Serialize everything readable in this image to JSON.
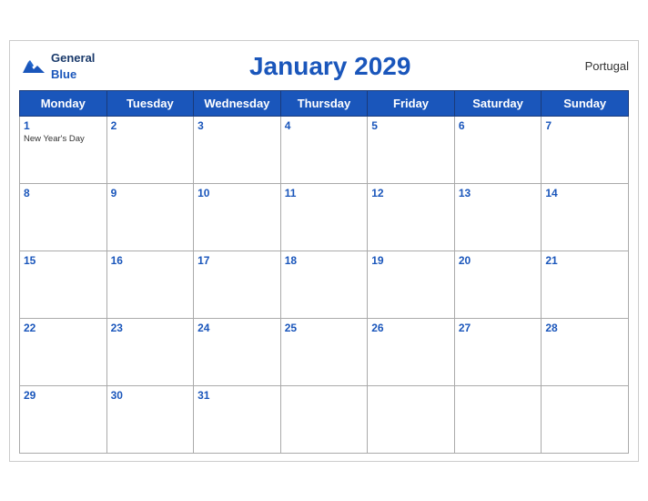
{
  "header": {
    "logo_general": "General",
    "logo_blue": "Blue",
    "title": "January 2029",
    "country": "Portugal"
  },
  "days_of_week": [
    "Monday",
    "Tuesday",
    "Wednesday",
    "Thursday",
    "Friday",
    "Saturday",
    "Sunday"
  ],
  "weeks": [
    [
      {
        "day": 1,
        "holiday": "New Year's Day"
      },
      {
        "day": 2
      },
      {
        "day": 3
      },
      {
        "day": 4
      },
      {
        "day": 5
      },
      {
        "day": 6
      },
      {
        "day": 7
      }
    ],
    [
      {
        "day": 8
      },
      {
        "day": 9
      },
      {
        "day": 10
      },
      {
        "day": 11
      },
      {
        "day": 12
      },
      {
        "day": 13
      },
      {
        "day": 14
      }
    ],
    [
      {
        "day": 15
      },
      {
        "day": 16
      },
      {
        "day": 17
      },
      {
        "day": 18
      },
      {
        "day": 19
      },
      {
        "day": 20
      },
      {
        "day": 21
      }
    ],
    [
      {
        "day": 22
      },
      {
        "day": 23
      },
      {
        "day": 24
      },
      {
        "day": 25
      },
      {
        "day": 26
      },
      {
        "day": 27
      },
      {
        "day": 28
      }
    ],
    [
      {
        "day": 29
      },
      {
        "day": 30
      },
      {
        "day": 31
      },
      {
        "day": null
      },
      {
        "day": null
      },
      {
        "day": null
      },
      {
        "day": null
      }
    ]
  ]
}
